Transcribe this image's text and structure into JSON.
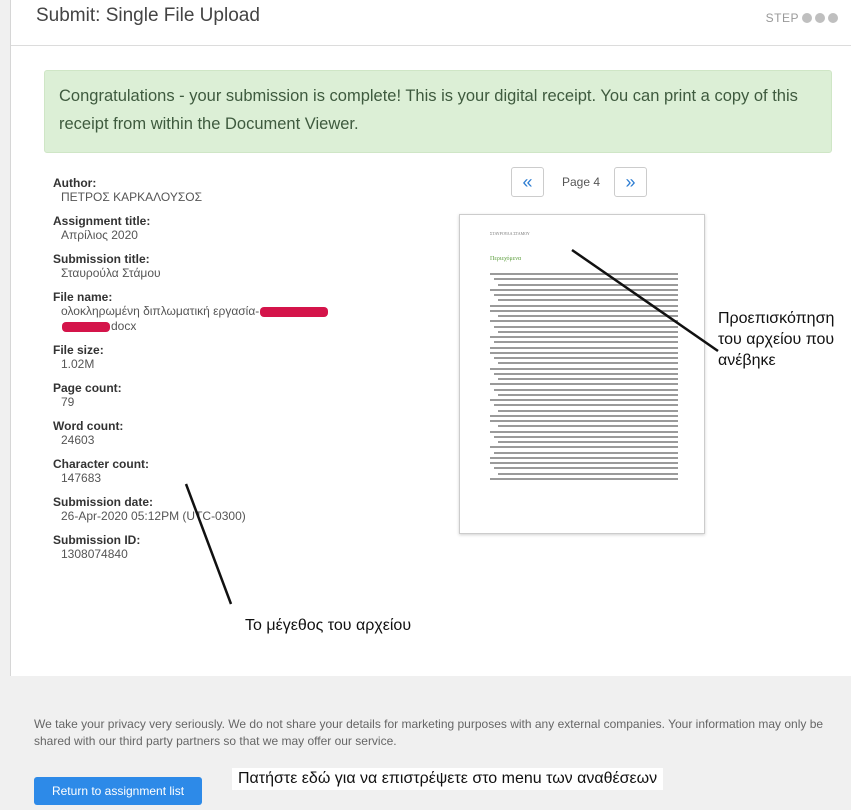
{
  "header": {
    "title": "Submit: Single File Upload",
    "step_label": "STEP"
  },
  "alert": {
    "text": "Congratulations - your submission is complete! This is your digital receipt. You can print a copy of this receipt from within the Document Viewer."
  },
  "meta": {
    "author_label": "Author:",
    "author": "ΠΕΤΡΟΣ ΚΑΡΚΑΛΟΥΣΟΣ",
    "assignment_title_label": "Assignment title:",
    "assignment_title": "Απρίλιος 2020",
    "submission_title_label": "Submission title:",
    "submission_title": "Σταυρούλα Στάμου",
    "file_name_label": "File name:",
    "file_name_part1": "ολοκληρωμένη διπλωματική εργασία-",
    "file_name_part2": "docx",
    "file_size_label": "File size:",
    "file_size": "1.02M",
    "page_count_label": "Page count:",
    "page_count": "79",
    "word_count_label": "Word count:",
    "word_count": "24603",
    "char_count_label": "Character count:",
    "char_count": "147683",
    "submission_date_label": "Submission date:",
    "submission_date": "26-Apr-2020 05:12PM (UTC-0300)",
    "submission_id_label": "Submission ID:",
    "submission_id": "1308074840"
  },
  "viewer": {
    "prev_icon": "«",
    "next_icon": "»",
    "page_label": "Page 4",
    "doc_header": "ΣΤΑΥΡΟΥΛΑ ΣΤΑΜΟΥ",
    "doc_title": "Περιεχόμενα"
  },
  "annotations": {
    "preview_line1": "Προεπισκόπηση",
    "preview_line2": "του αρχείου που",
    "preview_line3": "ανέβηκε",
    "size_note": "Το μέγεθος του αρχείου",
    "button_note": "Πατήστε εδώ για να επιστρέψετε στο menu των αναθέσεων"
  },
  "footer": {
    "privacy": "We take your privacy very seriously. We do not share your details for marketing purposes with any external companies. Your information may only be shared with our third party partners so that we may offer our service.",
    "return_button": "Return to assignment list"
  }
}
